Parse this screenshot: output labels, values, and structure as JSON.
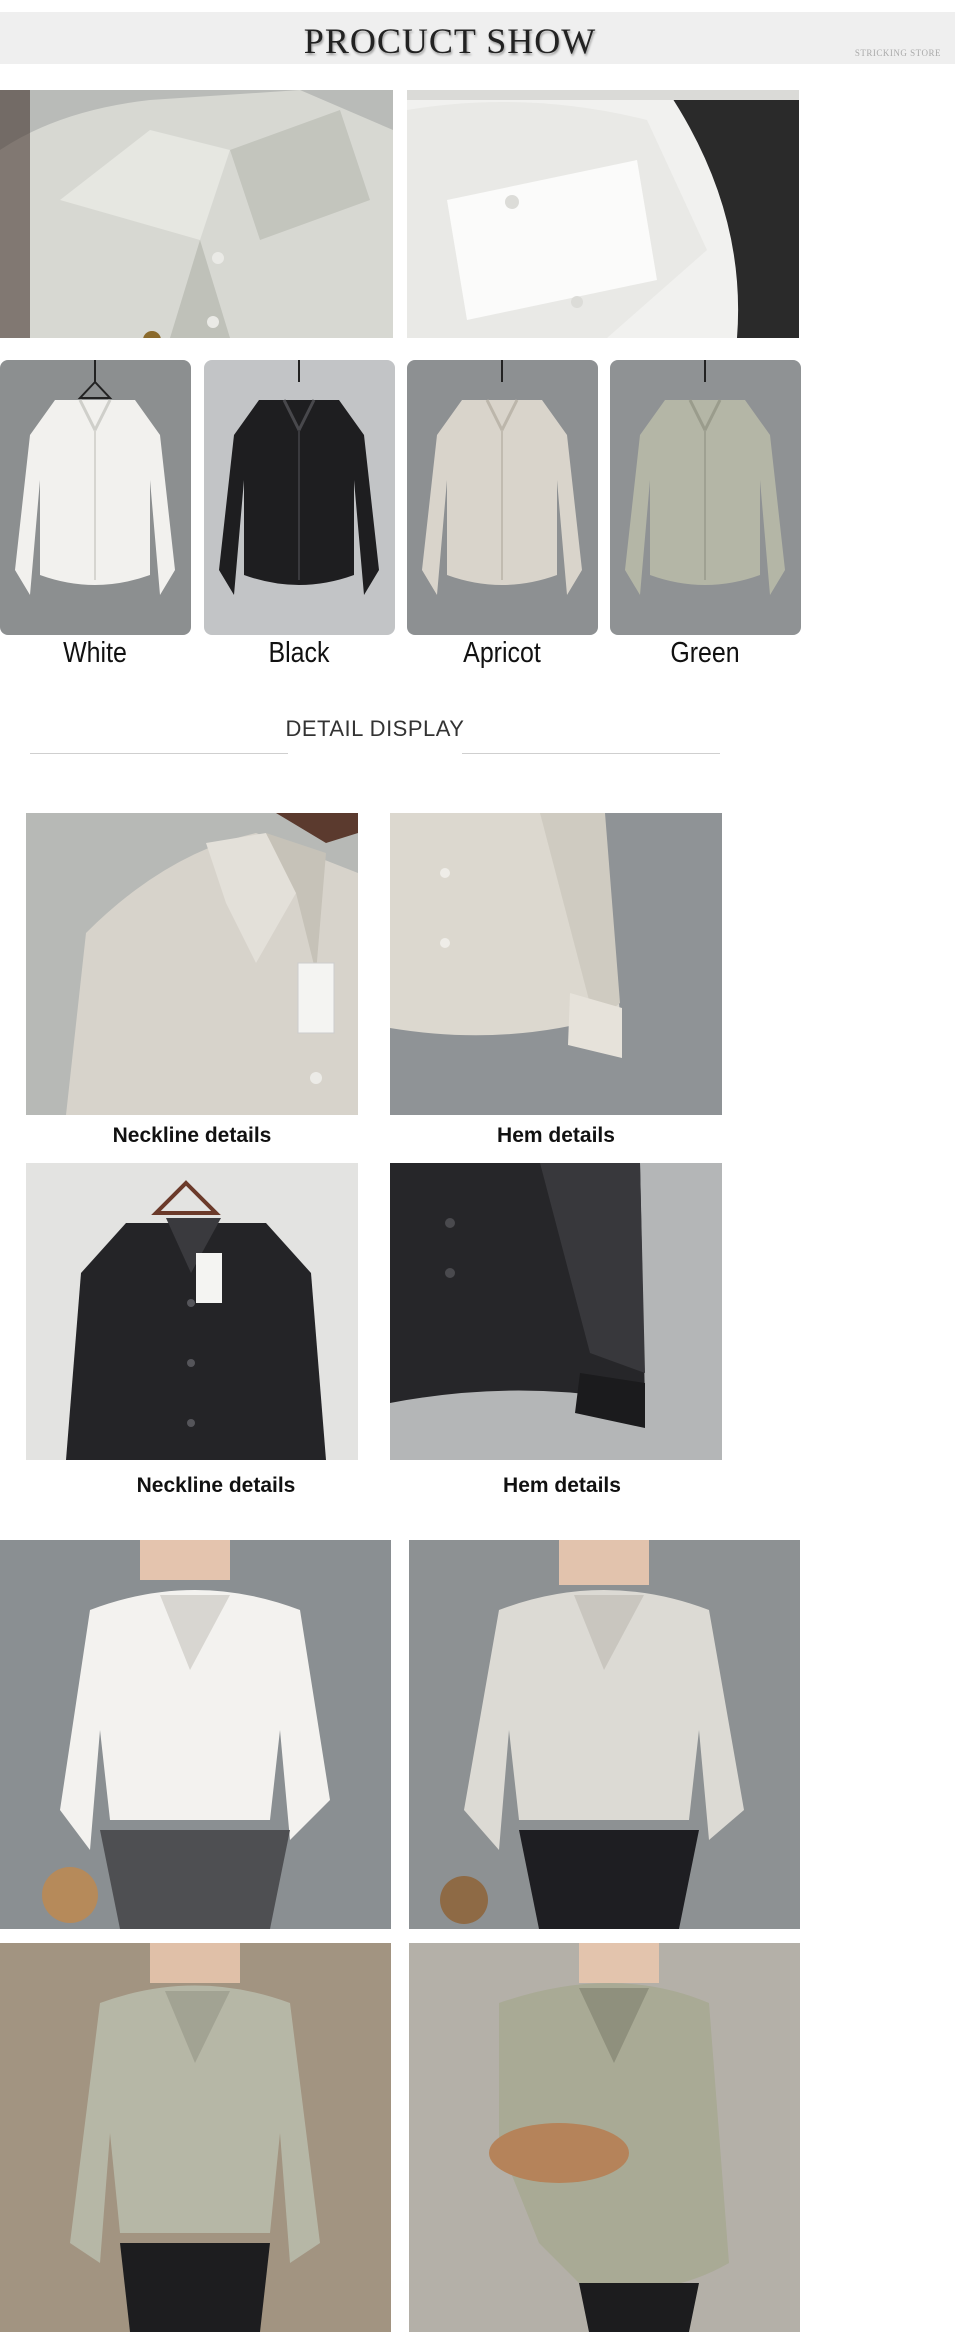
{
  "header": {
    "title": "PROCUCT SHOW",
    "watermark": "STRICKING STORE"
  },
  "colors": {
    "items": [
      {
        "label": "White",
        "swatch": "#f2f1ee"
      },
      {
        "label": "Black",
        "swatch": "#1e1e20"
      },
      {
        "label": "Apricot",
        "swatch": "#d9d4cb"
      },
      {
        "label": "Green",
        "swatch": "#b4b6a6"
      }
    ]
  },
  "detail": {
    "title": "DETAIL DISPLAY",
    "captions": [
      "Neckline details",
      "Hem details",
      "Neckline details",
      "Hem details"
    ]
  },
  "palette": {
    "banner_bg": "#efefef",
    "wall_gray": "#8e9294",
    "wall_light": "#d8d9d6"
  }
}
